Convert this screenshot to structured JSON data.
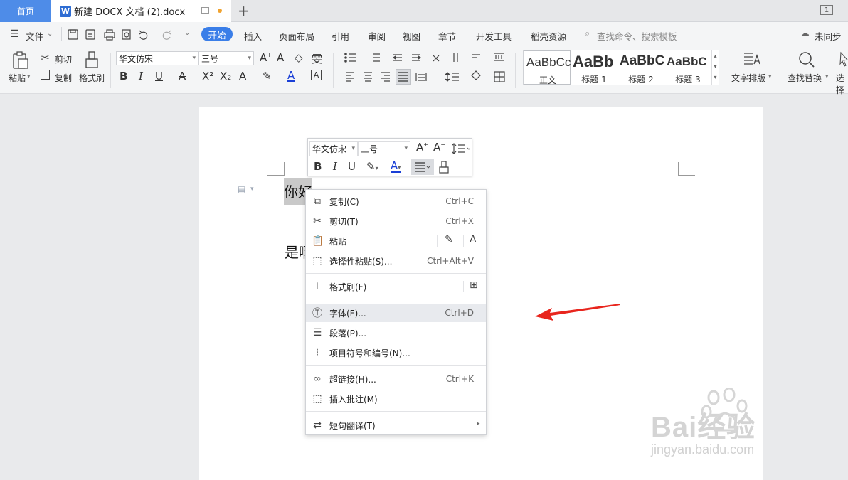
{
  "tabs": {
    "home": "首页",
    "doc_title": "新建 DOCX 文档 (2).docx",
    "new_tab": "+",
    "page_count": "1"
  },
  "menu": {
    "file": "文件",
    "items": [
      "开始",
      "插入",
      "页面布局",
      "引用",
      "审阅",
      "视图",
      "章节",
      "开发工具",
      "稻壳资源"
    ],
    "search_placeholder": "查找命令、搜索模板",
    "sync": "未同步"
  },
  "ribbon": {
    "paste": "粘贴",
    "cut": "剪切",
    "copy": "复制",
    "format_painter": "格式刷",
    "font_name": "华文仿宋",
    "font_size": "三号",
    "styles": [
      {
        "sample": "AaBbCcI",
        "name": "正文"
      },
      {
        "sample": "AaBb",
        "name": "标题 1"
      },
      {
        "sample": "AaBbC",
        "name": "标题 2"
      },
      {
        "sample": "AaBbC",
        "name": "标题 3"
      }
    ],
    "text_layout": "文字排版",
    "find_replace": "查找替换",
    "select": "选择"
  },
  "document": {
    "line1": "你好",
    "line2": "是啊"
  },
  "mini_toolbar": {
    "font_name": "华文仿宋",
    "font_size": "三号"
  },
  "context_menu": {
    "items": [
      {
        "label": "复制(C)",
        "shortcut": "Ctrl+C",
        "icon": "copy-icon"
      },
      {
        "label": "剪切(T)",
        "shortcut": "Ctrl+X",
        "icon": "scissors-icon"
      },
      {
        "label": "粘贴",
        "shortcut": "",
        "icon": "paste-icon"
      },
      {
        "label": "选择性粘贴(S)...",
        "shortcut": "Ctrl+Alt+V",
        "icon": "paste-special-icon"
      },
      {
        "label": "格式刷(F)",
        "shortcut": "",
        "icon": "format-brush-icon"
      },
      {
        "label": "字体(F)...",
        "shortcut": "Ctrl+D",
        "icon": "font-icon"
      },
      {
        "label": "段落(P)...",
        "shortcut": "",
        "icon": "paragraph-icon"
      },
      {
        "label": "项目符号和编号(N)...",
        "shortcut": "",
        "icon": "list-icon"
      },
      {
        "label": "超链接(H)...",
        "shortcut": "Ctrl+K",
        "icon": "link-icon"
      },
      {
        "label": "插入批注(M)",
        "shortcut": "",
        "icon": "comment-icon"
      },
      {
        "label": "短句翻译(T)",
        "shortcut": "",
        "icon": "translate-icon"
      }
    ]
  },
  "watermark": {
    "brand": "Bai经验",
    "url": "jingyan.baidu.com"
  },
  "colors": {
    "accent": "#3a7ee8",
    "arrow": "#e8251d"
  }
}
